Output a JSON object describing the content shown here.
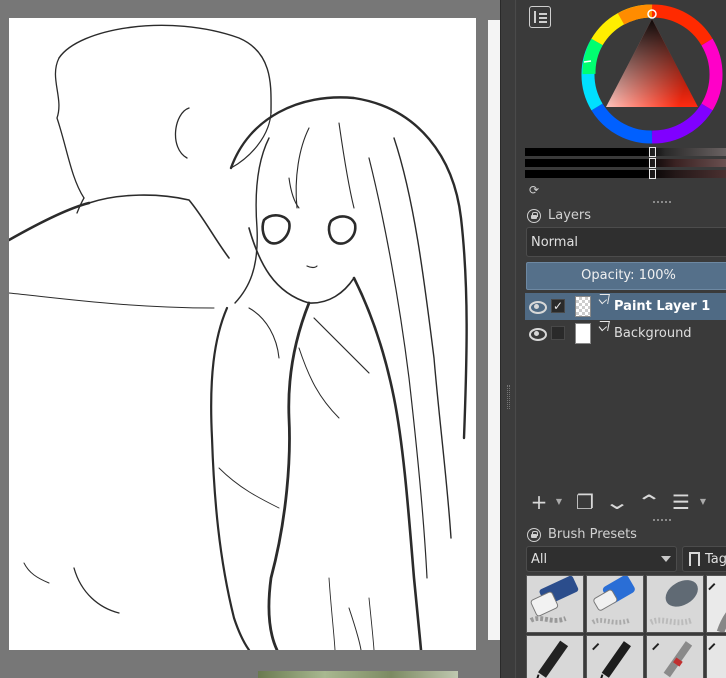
{
  "canvas": {
    "name": "drawing-canvas"
  },
  "colors": {
    "panel_bg": "#3a3a3a",
    "selection_blue": "#4f6a84",
    "opacity_bar": "#55708a",
    "canvas_surround": "#777777"
  },
  "layers_docker": {
    "title": "Layers",
    "blend_mode": "Normal",
    "opacity_label": "Opacity:  100%",
    "layers": [
      {
        "name": "Paint Layer 1",
        "visible": true,
        "selected": true,
        "checked": true,
        "thumbnail": "transparent"
      },
      {
        "name": "Background",
        "visible": true,
        "selected": false,
        "checked": false,
        "thumbnail": "white"
      }
    ],
    "toolbar": [
      {
        "icon": "plus-icon",
        "label": "+"
      },
      {
        "icon": "copy-icon",
        "label": "❐"
      },
      {
        "icon": "move-down-icon",
        "label": "⌄"
      },
      {
        "icon": "move-up-icon",
        "label": "⌃"
      },
      {
        "icon": "properties-icon",
        "label": "☰"
      }
    ]
  },
  "brush_presets_docker": {
    "title": "Brush Presets",
    "filter_value": "All",
    "tag_label": "Tag",
    "presets": [
      {
        "icon": "eraser-icon"
      },
      {
        "icon": "blue-eraser-icon"
      },
      {
        "icon": "soft-eraser-icon"
      },
      {
        "icon": "pencil-icon"
      },
      {
        "icon": "marker-pen-icon"
      },
      {
        "icon": "ink-pen-icon"
      },
      {
        "icon": "technical-pen-icon"
      },
      {
        "icon": "fineliner-icon"
      }
    ]
  }
}
